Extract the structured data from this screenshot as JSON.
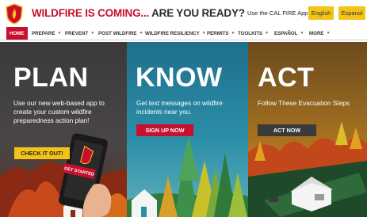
{
  "header": {
    "headline_red": "WILDFIRE IS COMING...",
    "headline_dark": " ARE YOU READY?",
    "app_label": "Use the CAL FIRE App:",
    "lang_english": "English",
    "lang_spanish": "Espanol"
  },
  "nav": {
    "items": [
      {
        "label": "HOME"
      },
      {
        "label": "PREPARE"
      },
      {
        "label": "PREVENT"
      },
      {
        "label": "POST WILDFIRE"
      },
      {
        "label": "WILDFIRE RESILIENCY"
      },
      {
        "label": "PERMITS"
      },
      {
        "label": "TOOLKITS"
      },
      {
        "label": "ESPAÑOL"
      },
      {
        "label": "MORE"
      }
    ]
  },
  "hero": {
    "plan": {
      "title": "PLAN",
      "description": "Use our new web-based app to create your custom wildfire preparedness action plan!",
      "cta": "CHECK IT OUT!",
      "phone_button": "GET STARTED"
    },
    "know": {
      "title": "KNOW",
      "description": "Get text messages on wildfire incidents near you.",
      "cta": "SIGN UP NOW"
    },
    "act": {
      "title": "ACT",
      "description": "Follow These Evacuation Steps",
      "cta": "ACT NOW"
    }
  },
  "colors": {
    "brand_red": "#c8102e",
    "brand_yellow": "#f2c417"
  }
}
